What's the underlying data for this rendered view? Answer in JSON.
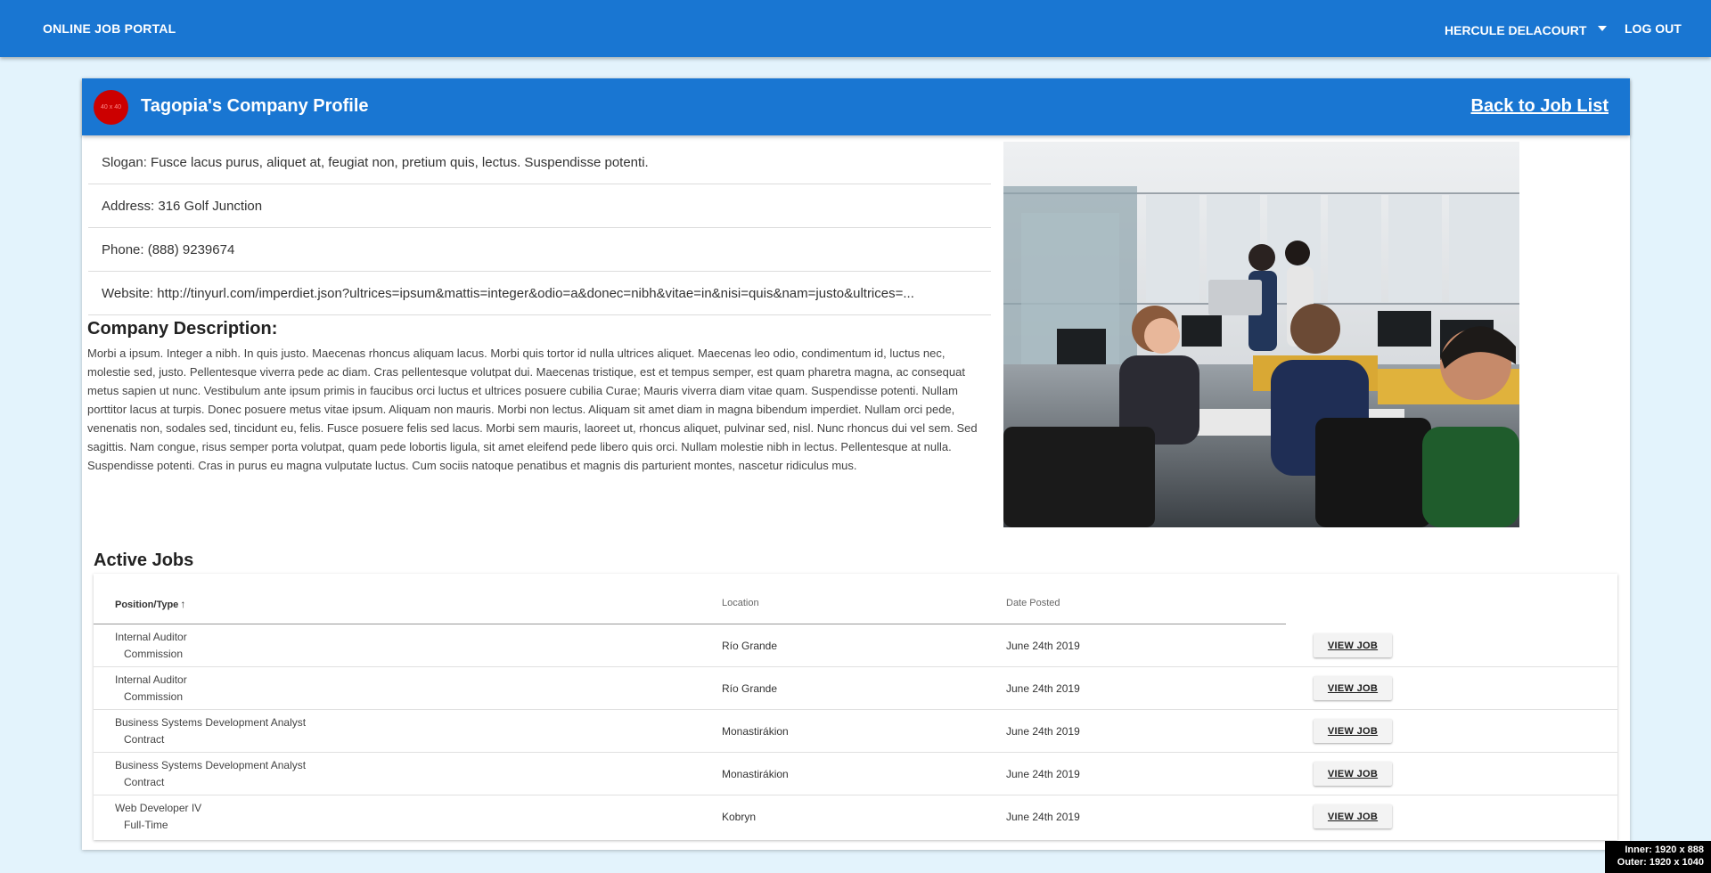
{
  "appbar": {
    "brand": "ONLINE JOB PORTAL",
    "user": "HERCULE DELACOURT",
    "logout": "LOG OUT"
  },
  "header": {
    "avatar_text": "40 x 40",
    "title": "Tagopia's Company Profile",
    "back_link": "Back to Job List"
  },
  "info": {
    "slogan": "Slogan: Fusce lacus purus, aliquet at, feugiat non, pretium quis, lectus. Suspendisse potenti.",
    "address": "Address: 316 Golf Junction",
    "phone": "Phone: (888) 9239674",
    "website": "Website: http://tinyurl.com/imperdiet.json?ultrices=ipsum&mattis=integer&odio=a&donec=nibh&vitae=in&nisi=quis&nam=justo&ultrices=..."
  },
  "description": {
    "title": "Company Description:",
    "text": "Morbi a ipsum. Integer a nibh. In quis justo. Maecenas rhoncus aliquam lacus. Morbi quis tortor id nulla ultrices aliquet. Maecenas leo odio, condimentum id, luctus nec, molestie sed, justo. Pellentesque viverra pede ac diam. Cras pellentesque volutpat dui. Maecenas tristique, est et tempus semper, est quam pharetra magna, ac consequat metus sapien ut nunc. Vestibulum ante ipsum primis in faucibus orci luctus et ultrices posuere cubilia Curae; Mauris viverra diam vitae quam. Suspendisse potenti. Nullam porttitor lacus at turpis. Donec posuere metus vitae ipsum. Aliquam non mauris. Morbi non lectus. Aliquam sit amet diam in magna bibendum imperdiet. Nullam orci pede, venenatis non, sodales sed, tincidunt eu, felis. Fusce posuere felis sed lacus. Morbi sem mauris, laoreet ut, rhoncus aliquet, pulvinar sed, nisl. Nunc rhoncus dui vel sem. Sed sagittis. Nam congue, risus semper porta volutpat, quam pede lobortis ligula, sit amet eleifend pede libero quis orci. Nullam molestie nibh in lectus. Pellentesque at nulla. Suspendisse potenti. Cras in purus eu magna vulputate luctus. Cum sociis natoque penatibus et magnis dis parturient montes, nascetur ridiculus mus."
  },
  "jobs": {
    "title": "Active Jobs",
    "columns": {
      "position": "Position/Type",
      "sort_icon": "arrow-up-icon",
      "location": "Location",
      "date": "Date Posted"
    },
    "rows": [
      {
        "position": "Internal Auditor",
        "type": "Commission",
        "location": "Río Grande",
        "date": "June 24th 2019",
        "action": "VIEW JOB"
      },
      {
        "position": "Internal Auditor",
        "type": "Commission",
        "location": "Río Grande",
        "date": "June 24th 2019",
        "action": "VIEW JOB"
      },
      {
        "position": "Business Systems Development Analyst",
        "type": "Contract",
        "location": "Monastirákion",
        "date": "June 24th 2019",
        "action": "VIEW JOB"
      },
      {
        "position": "Business Systems Development Analyst",
        "type": "Contract",
        "location": "Monastirákion",
        "date": "June 24th 2019",
        "action": "VIEW JOB"
      },
      {
        "position": "Web Developer IV",
        "type": "Full-Time",
        "location": "Kobryn",
        "date": "June 24th 2019",
        "action": "VIEW JOB"
      }
    ]
  },
  "viewport": {
    "inner": "Inner: 1920 x 888",
    "outer": "Outer: 1920 x 1040"
  },
  "colors": {
    "primary": "#1976d2",
    "background": "#e3f3fc",
    "avatar": "#cc0000"
  }
}
